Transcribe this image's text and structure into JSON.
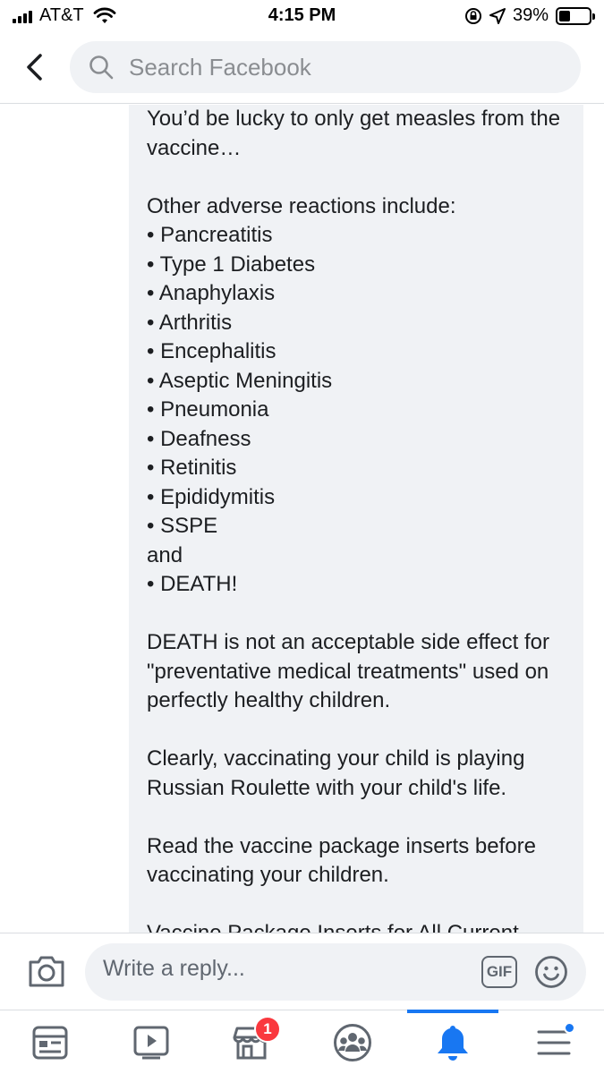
{
  "status_bar": {
    "carrier": "AT&T",
    "time": "4:15 PM",
    "battery_percent": "39%",
    "battery_level": 0.39
  },
  "header": {
    "search_placeholder": "Search Facebook"
  },
  "comment": {
    "text": "You’d be lucky to only get measles from the vaccine…\n\nOther adverse reactions include:\n• Pancreatitis\n• Type 1 Diabetes\n• Anaphylaxis\n• Arthritis\n• Encephalitis\n• Aseptic Meningitis\n• Pneumonia\n• Deafness\n• Retinitis\n• Epididymitis\n• SSPE\nand\n• DEATH!\n\nDEATH is not an acceptable side effect for \"preventative medical treatments\" used on perfectly healthy children.\n\nClearly, vaccinating your child is playing Russian Roulette with your child's life.\n\nRead the vaccine package inserts before vaccinating your children.\n\nVaccine Package Inserts for All Current"
  },
  "composer": {
    "reply_placeholder": "Write a reply...",
    "gif_label": "GIF"
  },
  "tab_bar": {
    "marketplace_badge": "1",
    "active_tab": "notifications",
    "accent_color": "#1877f2"
  },
  "colors": {
    "bubble_bg": "#f0f2f5",
    "badge": "#fa383e"
  }
}
